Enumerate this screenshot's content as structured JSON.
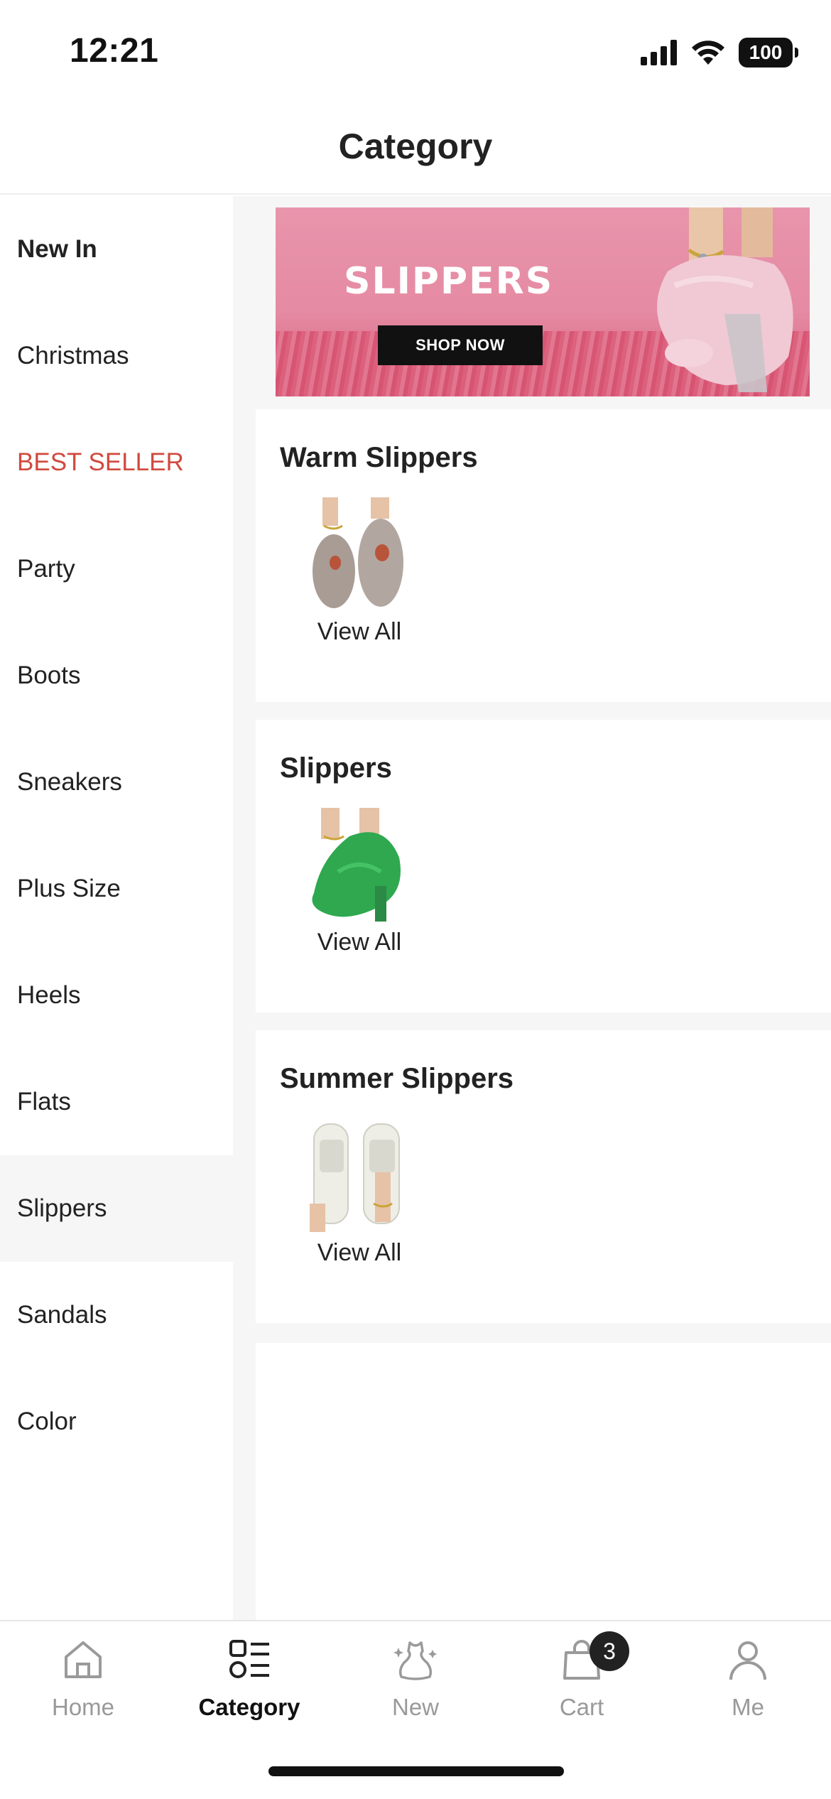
{
  "status_bar": {
    "time": "12:21",
    "battery": "100"
  },
  "header": {
    "title": "Category"
  },
  "sidebar": {
    "items": [
      {
        "label": "New In"
      },
      {
        "label": "Christmas"
      },
      {
        "label": "BEST SELLER"
      },
      {
        "label": "Party"
      },
      {
        "label": "Boots"
      },
      {
        "label": "Sneakers"
      },
      {
        "label": "Plus Size"
      },
      {
        "label": "Heels"
      },
      {
        "label": "Flats"
      },
      {
        "label": "Slippers"
      },
      {
        "label": "Sandals"
      },
      {
        "label": "Color"
      }
    ],
    "selected": "Slippers",
    "highlight_color": "#d04a3e"
  },
  "banner": {
    "title": "SLIPPERS",
    "button": "SHOP NOW",
    "background_color": "#e895ac"
  },
  "sections": [
    {
      "title": "Warm Slippers",
      "tile_label": "View All",
      "product_color": "#a89c95"
    },
    {
      "title": "Slippers",
      "tile_label": "View All",
      "product_color": "#2fa84f"
    },
    {
      "title": "Summer Slippers",
      "tile_label": "View All",
      "product_color": "#eeeee6"
    }
  ],
  "tabbar": {
    "tabs": [
      {
        "label": "Home",
        "icon": "home-icon"
      },
      {
        "label": "Category",
        "icon": "category-icon"
      },
      {
        "label": "New",
        "icon": "sparkle-dress-icon"
      },
      {
        "label": "Cart",
        "icon": "shopping-bag-icon",
        "badge": "3"
      },
      {
        "label": "Me",
        "icon": "person-icon"
      }
    ],
    "active": "Category"
  }
}
